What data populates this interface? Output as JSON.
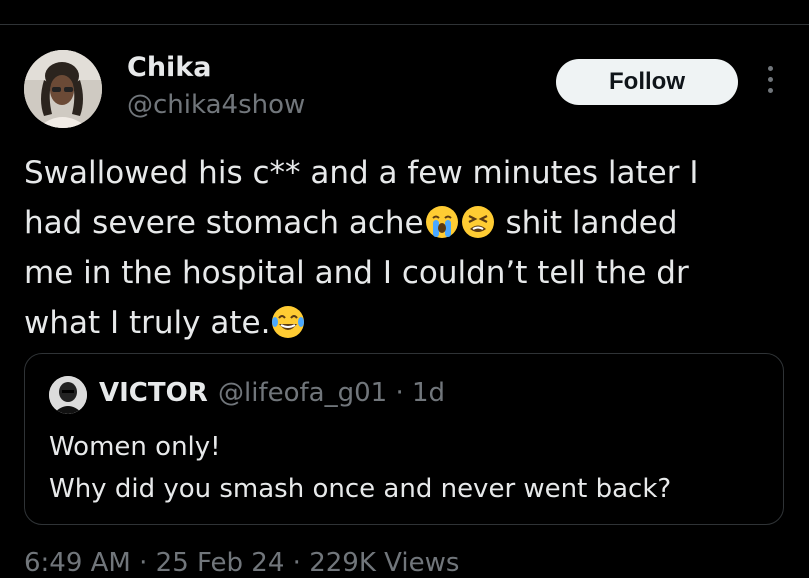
{
  "author": {
    "name": "Chika",
    "handle": "@chika4show",
    "avatar_icon": "profile-photo"
  },
  "follow_label": "Follow",
  "more_icon": "more-options-icon",
  "tweet": {
    "line1": "Swallowed his c** and a few minutes later I",
    "line2_a": "had severe stomach ache",
    "line2_b": " shit landed",
    "line3": "me in the hospital and I couldn’t tell the dr",
    "line4": "what I  truly ate."
  },
  "emojis": [
    "loudly-crying-face",
    "tired-face",
    "tears-of-joy-face"
  ],
  "quote": {
    "name": "VICTOR",
    "handle": "@lifeofa_g01",
    "separator": "·",
    "time": "1d",
    "text_line1": "Women only!",
    "text_line2": "Why did you smash once and never went back?"
  },
  "footer_partial": "6:49 AM · 25 Feb 24 · 229K Views",
  "colors": {
    "background": "#000000",
    "text": "#e7e9ea",
    "secondary": "#71767b",
    "border": "#2f3336",
    "follow_bg": "#eff3f4"
  }
}
